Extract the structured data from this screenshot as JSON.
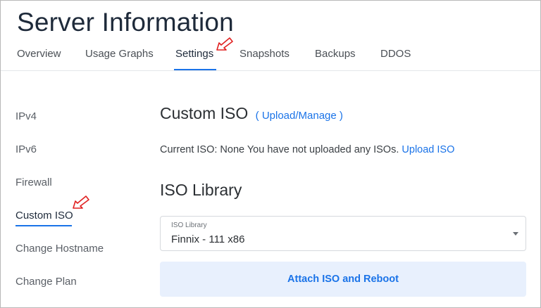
{
  "page": {
    "title": "Server Information"
  },
  "tabs": [
    {
      "label": "Overview",
      "active": false
    },
    {
      "label": "Usage Graphs",
      "active": false
    },
    {
      "label": "Settings",
      "active": true
    },
    {
      "label": "Snapshots",
      "active": false
    },
    {
      "label": "Backups",
      "active": false
    },
    {
      "label": "DDOS",
      "active": false
    }
  ],
  "sidebar": {
    "items": [
      {
        "label": "IPv4",
        "active": false
      },
      {
        "label": "IPv6",
        "active": false
      },
      {
        "label": "Firewall",
        "active": false
      },
      {
        "label": "Custom ISO",
        "active": true
      },
      {
        "label": "Change Hostname",
        "active": false
      },
      {
        "label": "Change Plan",
        "active": false
      }
    ]
  },
  "custom_iso": {
    "heading": "Custom ISO",
    "upload_manage_link": "( Upload/Manage )",
    "current_iso_text": "Current ISO: None You have not uploaded any ISOs.",
    "upload_iso_link": "Upload ISO"
  },
  "iso_library": {
    "heading": "ISO Library",
    "select_label": "ISO Library",
    "select_value": "Finnix - 111 x86",
    "attach_button": "Attach ISO and Reboot"
  },
  "annotation_icon": "red-hollow-arrow-icon",
  "colors": {
    "accent": "#1a73e8",
    "button_bg": "#e8f0fd",
    "annotation_arrow": "#e02020"
  }
}
